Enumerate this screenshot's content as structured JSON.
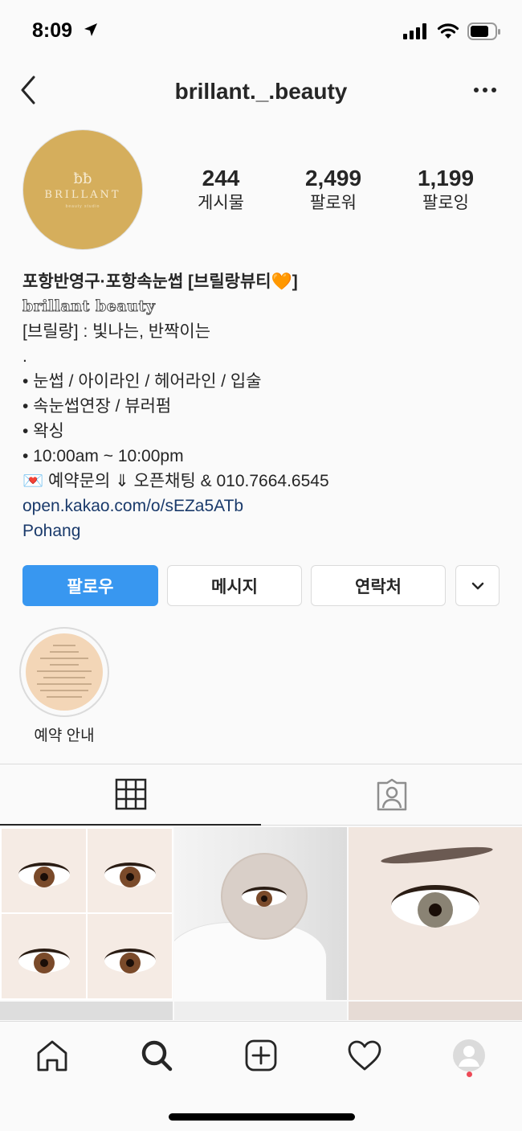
{
  "status_bar": {
    "time": "8:09"
  },
  "header": {
    "username": "brillant._.beauty"
  },
  "profile": {
    "avatar_mark": "ƀƀ",
    "avatar_text": "BRILLANT",
    "avatar_sub": "beauty studio"
  },
  "stats": [
    {
      "value": "244",
      "label": "게시물"
    },
    {
      "value": "2,499",
      "label": "팔로워"
    },
    {
      "value": "1,199",
      "label": "팔로잉"
    }
  ],
  "bio": {
    "name": "포항반영구·포항속눈썹  [브릴랑뷰티🧡]",
    "fancy": "brillant beauty",
    "lines": [
      "[브릴랑] : 빛나는, 반짝이는",
      ".",
      "• 눈썹 / 아이라인 / 헤어라인 / 입술",
      "• 속눈썹연장 / 뷰러펌",
      "• 왁싱",
      "• 10:00am ~ 10:00pm",
      "💌 예약문의 ⇓ 오픈채팅 & 010.7664.6545"
    ],
    "link": "open.kakao.com/o/sEZa5ATb",
    "location": "Pohang"
  },
  "actions": {
    "follow": "팔로우",
    "message": "메시지",
    "contact": "연락처"
  },
  "highlights": [
    {
      "label": "예약 안내"
    }
  ],
  "colors": {
    "accent": "#3897f0",
    "link": "#1a3a6b",
    "avatar_bg": "#d5ae5c",
    "notification": "#ed4956"
  },
  "icons": {
    "back": "chevron-left-icon",
    "more": "more-horizontal-icon",
    "grid": "grid-icon",
    "tagged": "tagged-person-icon",
    "home": "home-icon",
    "search": "search-icon",
    "add": "add-post-icon",
    "activity": "heart-icon",
    "profile": "profile-avatar-icon"
  }
}
